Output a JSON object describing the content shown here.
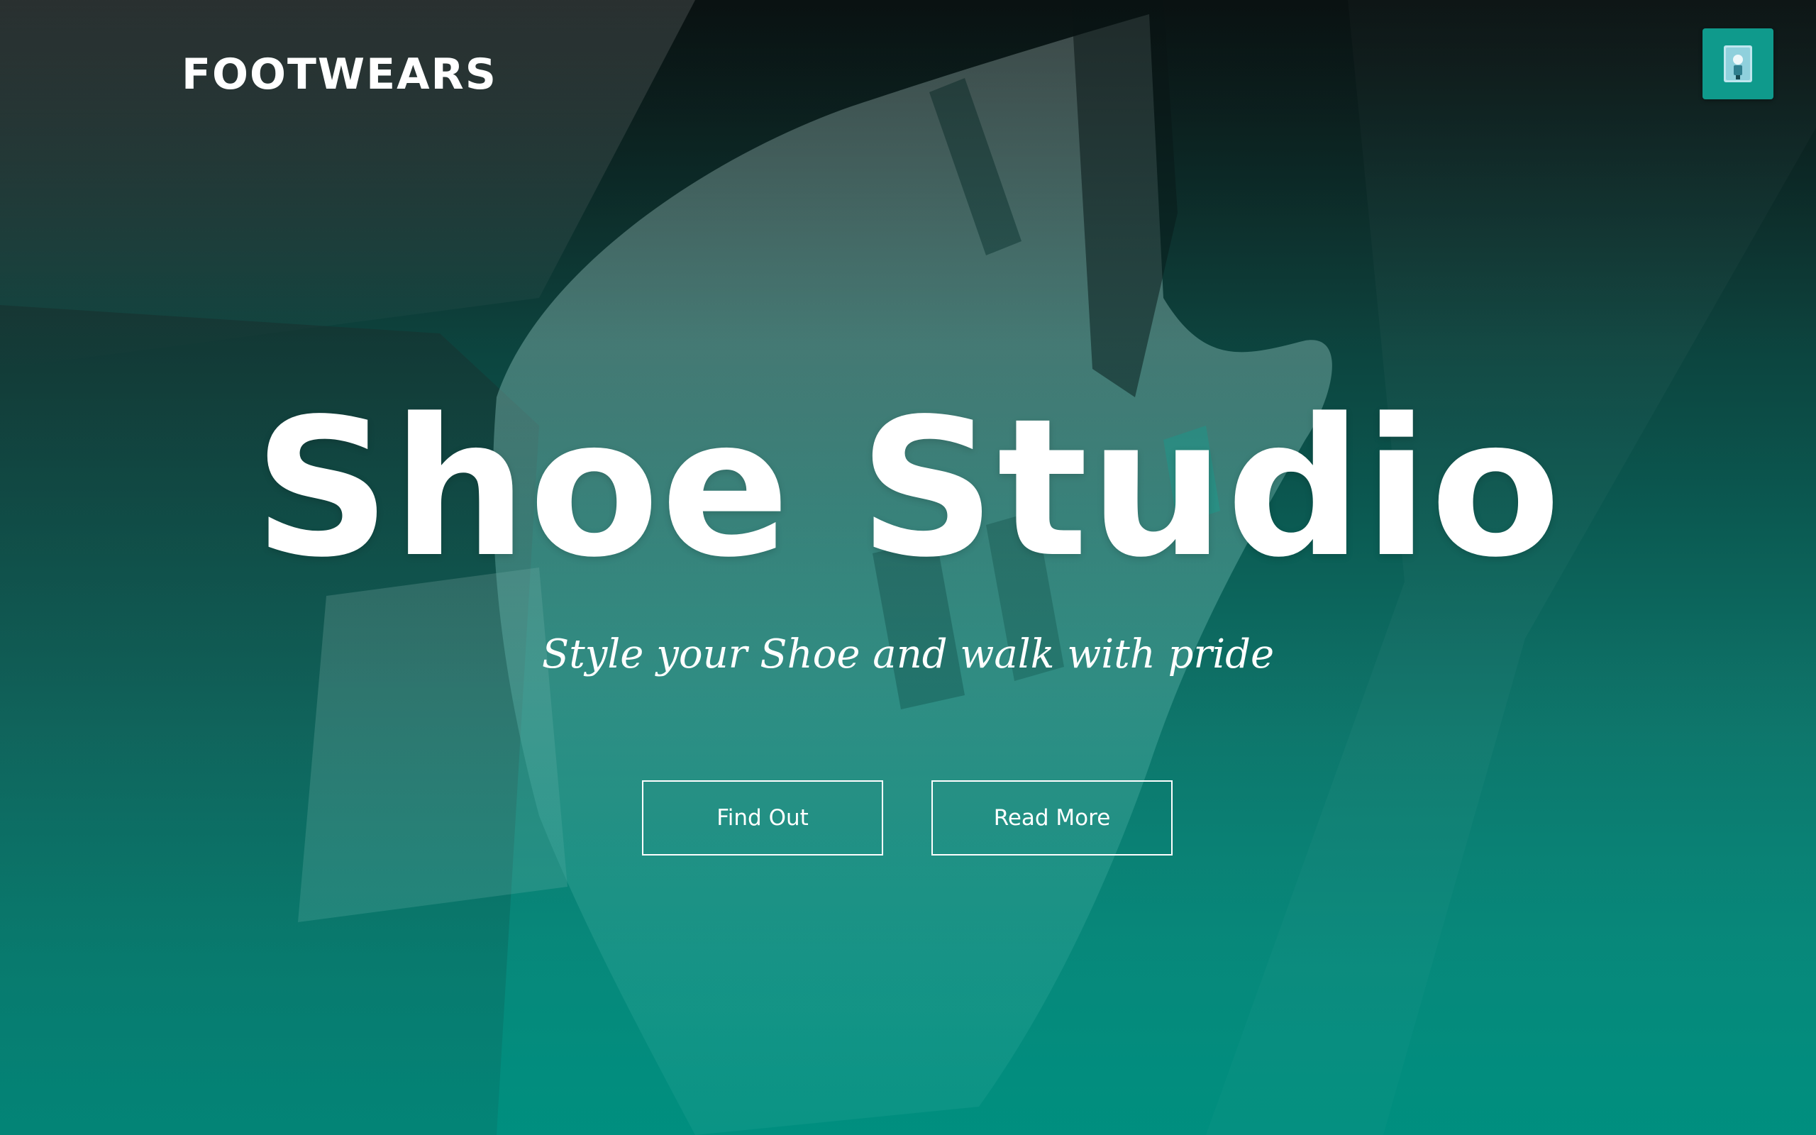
{
  "header": {
    "brand": "FOOTWEARS",
    "menu_icon": "menu-thumbnail-icon"
  },
  "hero": {
    "title": "Shoe Studio",
    "tagline": "Style your Shoe and walk with pride",
    "buttons": [
      {
        "label": "Find Out"
      },
      {
        "label": "Read More"
      }
    ],
    "background_image": "sneaker-photo",
    "colors": {
      "accent": "#0f9a8c",
      "gradient_top": "#0d1414",
      "gradient_bottom": "#009282",
      "text": "#ffffff"
    }
  }
}
